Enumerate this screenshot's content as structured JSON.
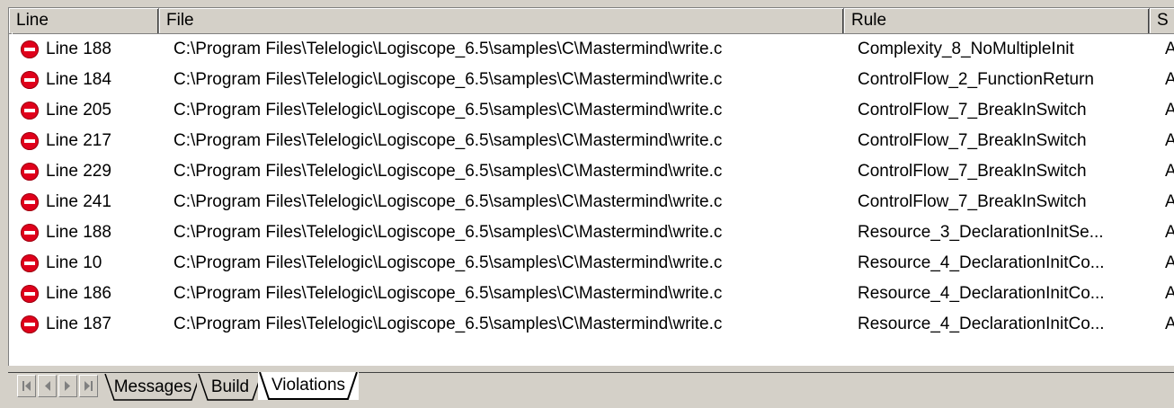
{
  "columns": {
    "line": "Line",
    "file": "File",
    "rule": "Rule",
    "extra": "S"
  },
  "rows": [
    {
      "line": "Line 188",
      "file": "C:\\Program Files\\Telelogic\\Logiscope_6.5\\samples\\C\\Mastermind\\write.c",
      "rule": "Complexity_8_NoMultipleInit",
      "extra": "A"
    },
    {
      "line": "Line 184",
      "file": "C:\\Program Files\\Telelogic\\Logiscope_6.5\\samples\\C\\Mastermind\\write.c",
      "rule": "ControlFlow_2_FunctionReturn",
      "extra": "A"
    },
    {
      "line": "Line 205",
      "file": "C:\\Program Files\\Telelogic\\Logiscope_6.5\\samples\\C\\Mastermind\\write.c",
      "rule": "ControlFlow_7_BreakInSwitch",
      "extra": "A"
    },
    {
      "line": "Line 217",
      "file": "C:\\Program Files\\Telelogic\\Logiscope_6.5\\samples\\C\\Mastermind\\write.c",
      "rule": "ControlFlow_7_BreakInSwitch",
      "extra": "A"
    },
    {
      "line": "Line 229",
      "file": "C:\\Program Files\\Telelogic\\Logiscope_6.5\\samples\\C\\Mastermind\\write.c",
      "rule": "ControlFlow_7_BreakInSwitch",
      "extra": "A"
    },
    {
      "line": "Line 241",
      "file": "C:\\Program Files\\Telelogic\\Logiscope_6.5\\samples\\C\\Mastermind\\write.c",
      "rule": "ControlFlow_7_BreakInSwitch",
      "extra": "A"
    },
    {
      "line": "Line 188",
      "file": "C:\\Program Files\\Telelogic\\Logiscope_6.5\\samples\\C\\Mastermind\\write.c",
      "rule": "Resource_3_DeclarationInitSe...",
      "extra": "A"
    },
    {
      "line": "Line 10",
      "file": "C:\\Program Files\\Telelogic\\Logiscope_6.5\\samples\\C\\Mastermind\\write.c",
      "rule": "Resource_4_DeclarationInitCo...",
      "extra": "A"
    },
    {
      "line": "Line 186",
      "file": "C:\\Program Files\\Telelogic\\Logiscope_6.5\\samples\\C\\Mastermind\\write.c",
      "rule": "Resource_4_DeclarationInitCo...",
      "extra": "A"
    },
    {
      "line": "Line 187",
      "file": "C:\\Program Files\\Telelogic\\Logiscope_6.5\\samples\\C\\Mastermind\\write.c",
      "rule": "Resource_4_DeclarationInitCo...",
      "extra": "A"
    }
  ],
  "row_icon": "error-stop-icon",
  "tabs": {
    "messages": "Messages",
    "build": "Build",
    "violations": "Violations"
  },
  "active_tab": "Violations",
  "nav_icons": [
    "first-tab-icon",
    "prev-tab-icon",
    "next-tab-icon",
    "last-tab-icon"
  ],
  "colors": {
    "error_icon": "#e0001b",
    "face": "#d4d0c8",
    "list_background": "#ffffff"
  }
}
